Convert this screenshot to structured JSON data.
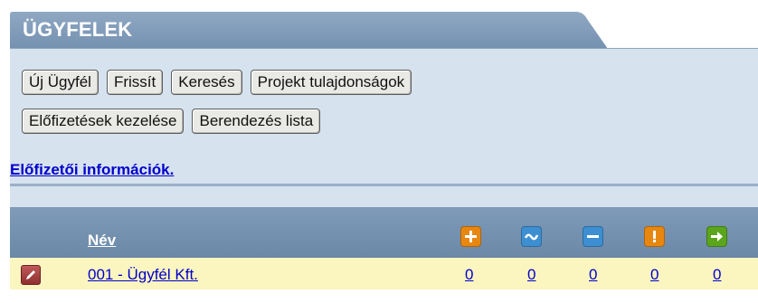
{
  "section": {
    "title": "ÜGYFELEK"
  },
  "toolbar": {
    "row1": [
      "Új Ügyfél",
      "Frissít",
      "Keresés",
      "Projekt tulajdonságok"
    ],
    "row2": [
      "Előfizetések kezelése",
      "Berendezés lista"
    ]
  },
  "info_link": "Előfizetői információk.",
  "table": {
    "name_header": "Név",
    "action_icons": [
      {
        "icon": "plus-icon",
        "color": "#e8870f"
      },
      {
        "icon": "wave-icon",
        "color": "#3d8fd1"
      },
      {
        "icon": "minus-icon",
        "color": "#3d8fd1"
      },
      {
        "icon": "exclamation-icon",
        "color": "#e8870f"
      },
      {
        "icon": "arrow-right-icon",
        "color": "#5aa51c"
      }
    ],
    "rows": [
      {
        "name": "001 - Ügyfél Kft.",
        "counts": [
          "0",
          "0",
          "0",
          "0",
          "0"
        ]
      }
    ]
  },
  "colors": {
    "header_blue": "#7f9bb9",
    "panel_blue": "#d6e2ee",
    "row_yellow": "#fbf6c0",
    "link_blue": "#0000cc"
  }
}
